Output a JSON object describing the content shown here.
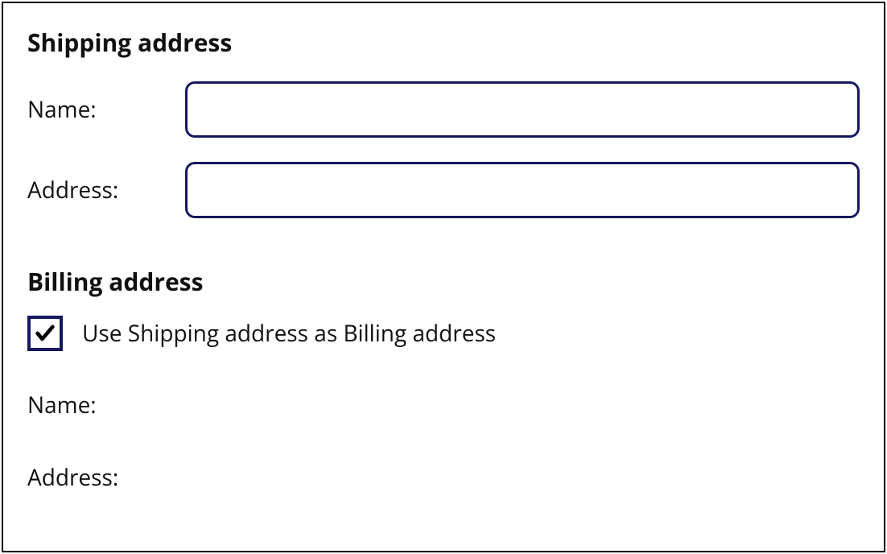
{
  "shipping": {
    "heading": "Shipping address",
    "name_label": "Name:",
    "name_value": "",
    "address_label": "Address:",
    "address_value": ""
  },
  "billing": {
    "heading": "Billing address",
    "use_shipping_label": "Use Shipping address as Billing address",
    "use_shipping_checked": true,
    "name_label": "Name:",
    "address_label": "Address:"
  }
}
